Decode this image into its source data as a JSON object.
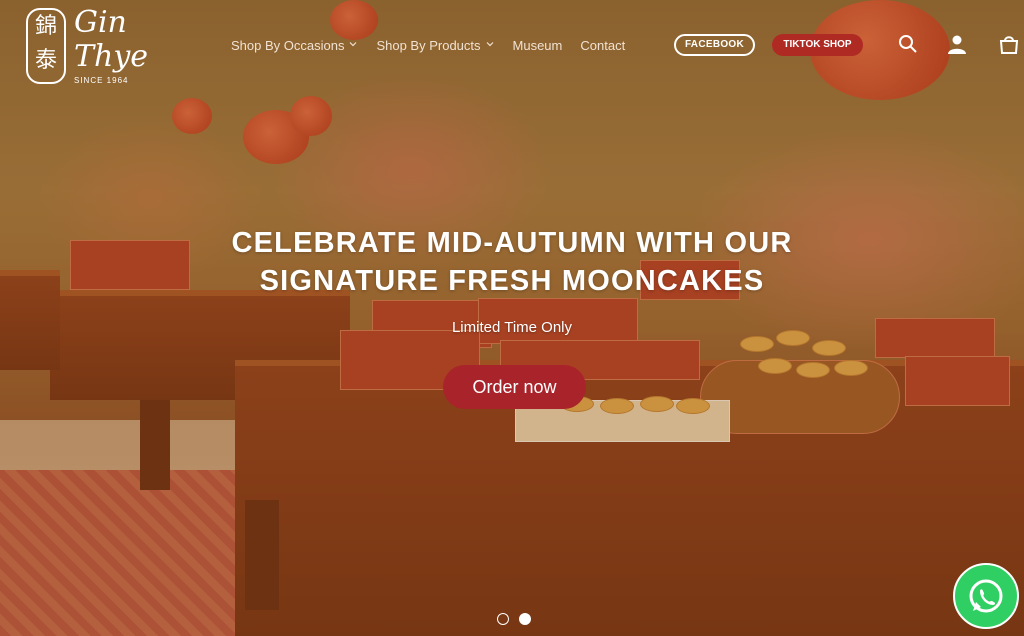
{
  "brand": {
    "name_line1": "Gin",
    "name_line2": "Thye",
    "since": "SINCE 1964",
    "seal_text": "錦泰"
  },
  "nav": {
    "items": [
      {
        "label": "Shop By Occasions",
        "has_dropdown": true
      },
      {
        "label": "Shop By Products",
        "has_dropdown": true
      },
      {
        "label": "Museum",
        "has_dropdown": false
      },
      {
        "label": "Contact",
        "has_dropdown": false
      }
    ],
    "facebook_label": "FACEBOOK",
    "tiktok_label": "TIKTOK SHOP",
    "icons": [
      "search-icon",
      "account-icon",
      "cart-icon"
    ]
  },
  "hero": {
    "headline": "CELEBRATE MID-AUTUMN WITH OUR SIGNATURE FRESH MOONCAKES",
    "subline": "Limited Time Only",
    "cta_label": "Order now",
    "slides": {
      "count": 2,
      "active": 2
    }
  },
  "floating": {
    "icon": "whatsapp-icon",
    "color": "#2fcf63"
  },
  "colors": {
    "accent": "#a9232a",
    "tiktok": "#b02a24",
    "overlay_tint": "#8c5014"
  }
}
